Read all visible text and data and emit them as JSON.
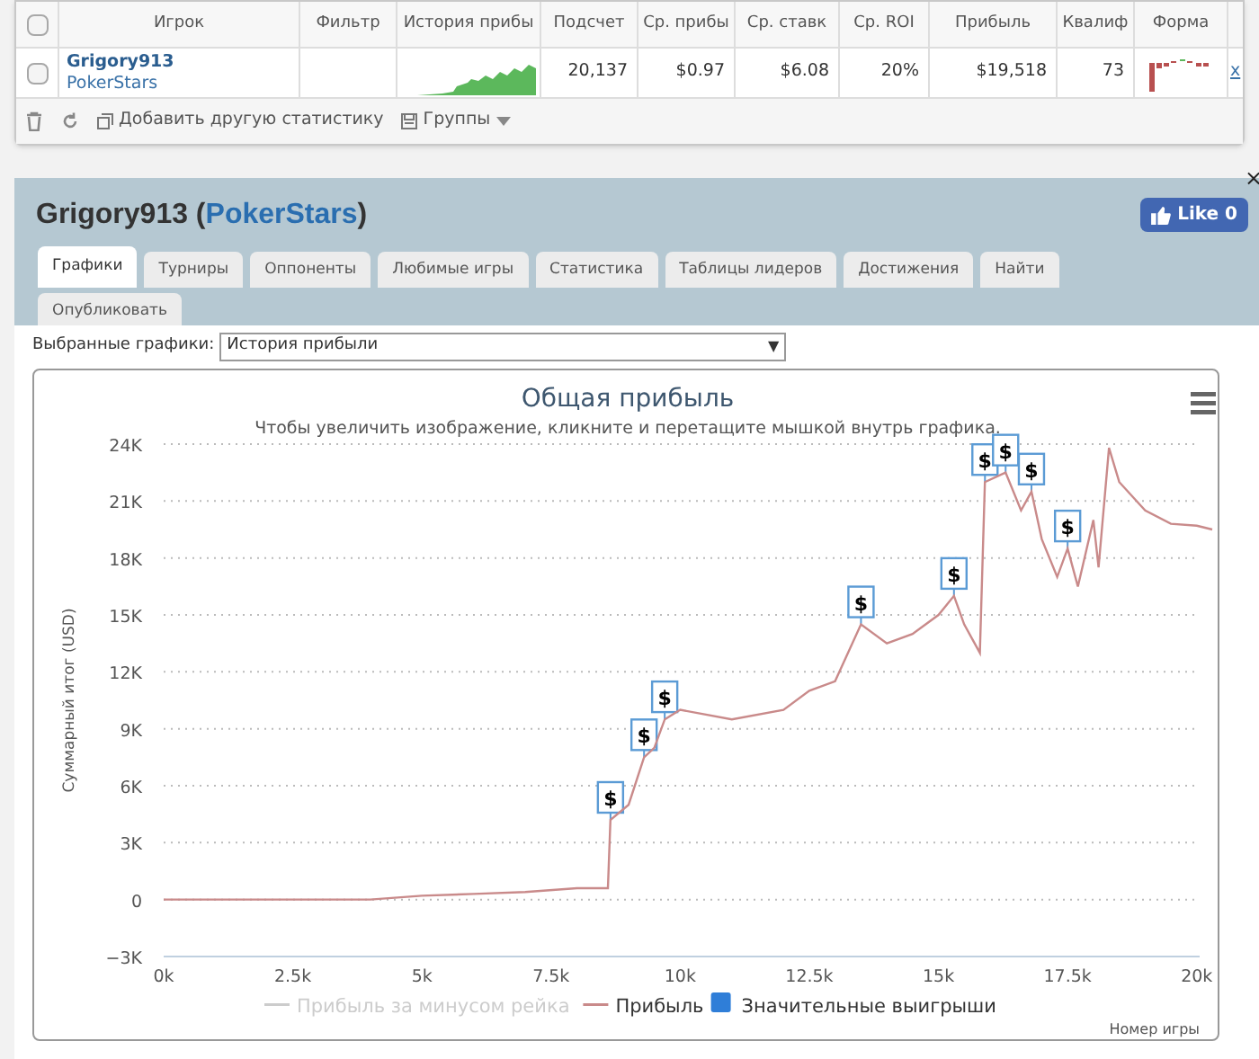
{
  "stats_table": {
    "columns": [
      "Игрок",
      "Фильтр",
      "История прибы",
      "Подсчет",
      "Ср. прибы",
      "Ср. ставк",
      "Ср. ROI",
      "Прибыль",
      "Квалиф",
      "Форма"
    ],
    "rows": [
      {
        "checked": false,
        "player": "Grigory913",
        "site": "PokerStars",
        "count": "20,137",
        "avg_profit": "$0.97",
        "avg_stake": "$6.08",
        "avg_roi": "20%",
        "profit": "$19,518",
        "qualif": "73",
        "column_11": "x"
      }
    ],
    "header_checked": false,
    "toolbar": {
      "add": "Добавить другую статистику",
      "groups": "Группы"
    }
  },
  "profile": {
    "title_prefix": "Grigory913 (",
    "title_link": "PokerStars",
    "title_suffix": ")",
    "close": "×",
    "like": "Like 0",
    "tabs": [
      {
        "label": "Графики",
        "selected": true
      },
      {
        "label": "Турниры",
        "selected": false
      },
      {
        "label": "Оппоненты",
        "selected": false
      },
      {
        "label": "Любимые игры",
        "selected": false
      },
      {
        "label": "Статистика",
        "selected": false
      },
      {
        "label": "Таблицы лидеров",
        "selected": false
      },
      {
        "label": "Достижения",
        "selected": false
      },
      {
        "label": "Найти",
        "selected": false
      },
      {
        "label": "Опубликовать",
        "selected": false
      }
    ],
    "graph_select": {
      "label": "Выбранные графики:",
      "value": "История прибыли",
      "arrow": "▼"
    }
  },
  "chart": {
    "hint": "Чтобы увеличить изображение, кликните и перетащите мышкой внутрь графика.",
    "legend": [
      {
        "kind": "line",
        "label": "Прибыль за минусом рейка",
        "hidden": true
      },
      {
        "kind": "series",
        "hidden": false
      },
      {
        "kind": "box",
        "label": "Значительные выигрыши",
        "color": "#2f7ed8",
        "hidden": false
      }
    ],
    "chart_data": {
      "type": "line",
      "title": "Общая прибыль",
      "xlabel": "Номер игры",
      "ylabel": "Суммарный итог (USD)",
      "grid": true,
      "x": [
        0,
        1000,
        2000,
        3000,
        4000,
        5000,
        6000,
        7000,
        8000,
        8600,
        8650,
        9000,
        9300,
        9500,
        9700,
        10000,
        11000,
        12000,
        12500,
        13000,
        13500,
        14000,
        14500,
        15000,
        15300,
        15500,
        15800,
        15900,
        16300,
        16600,
        16800,
        17000,
        17300,
        17500,
        17700,
        18000,
        18100,
        18300,
        18500,
        19000,
        19500,
        20000,
        20300
      ],
      "series": [
        {
          "name": "Прибыль",
          "color": "#c98a8a",
          "values": [
            0,
            0,
            0,
            0,
            0,
            200,
            300,
            400,
            600,
            600,
            4200,
            5000,
            7500,
            8000,
            9500,
            10000,
            9500,
            10000,
            11000,
            11500,
            14500,
            13500,
            14000,
            15000,
            16000,
            14500,
            13000,
            22000,
            22500,
            20500,
            21500,
            19000,
            17000,
            18500,
            16500,
            20000,
            17500,
            23800,
            22000,
            20500,
            19800,
            19700,
            19500
          ]
        }
      ],
      "xlim": [
        0,
        20300
      ],
      "ylim": [
        -3000,
        24000
      ],
      "xticks": [
        {
          "value": 0,
          "label": "0k"
        },
        {
          "value": 2500,
          "label": "2.5k"
        },
        {
          "value": 5000,
          "label": "5k"
        },
        {
          "value": 7500,
          "label": "7.5k"
        },
        {
          "value": 10000,
          "label": "10k"
        },
        {
          "value": 12500,
          "label": "12.5k"
        },
        {
          "value": 15000,
          "label": "15k"
        },
        {
          "value": 17500,
          "label": "17.5k"
        },
        {
          "value": 20000,
          "label": "20k"
        }
      ],
      "yticks": [
        {
          "value": -3000,
          "label": "−3K"
        },
        {
          "value": 0,
          "label": "0"
        },
        {
          "value": 3000,
          "label": "3K"
        },
        {
          "value": 6000,
          "label": "6K"
        },
        {
          "value": 9000,
          "label": "9K"
        },
        {
          "value": 12000,
          "label": "12K"
        },
        {
          "value": 15000,
          "label": "15K"
        },
        {
          "value": 18000,
          "label": "18K"
        },
        {
          "value": 21000,
          "label": "21K"
        },
        {
          "value": 24000,
          "label": "24K"
        }
      ],
      "annotations": [
        {
          "x": 8650,
          "y": 4200,
          "text": "$"
        },
        {
          "x": 9300,
          "y": 7500,
          "text": "$"
        },
        {
          "x": 9700,
          "y": 9500,
          "text": "$"
        },
        {
          "x": 13500,
          "y": 14500,
          "text": "$"
        },
        {
          "x": 15300,
          "y": 16000,
          "text": "$"
        },
        {
          "x": 15900,
          "y": 22000,
          "text": "$"
        },
        {
          "x": 16300,
          "y": 22500,
          "text": "$"
        },
        {
          "x": 16800,
          "y": 21500,
          "text": "$"
        },
        {
          "x": 17500,
          "y": 18500,
          "text": "$"
        }
      ]
    }
  }
}
